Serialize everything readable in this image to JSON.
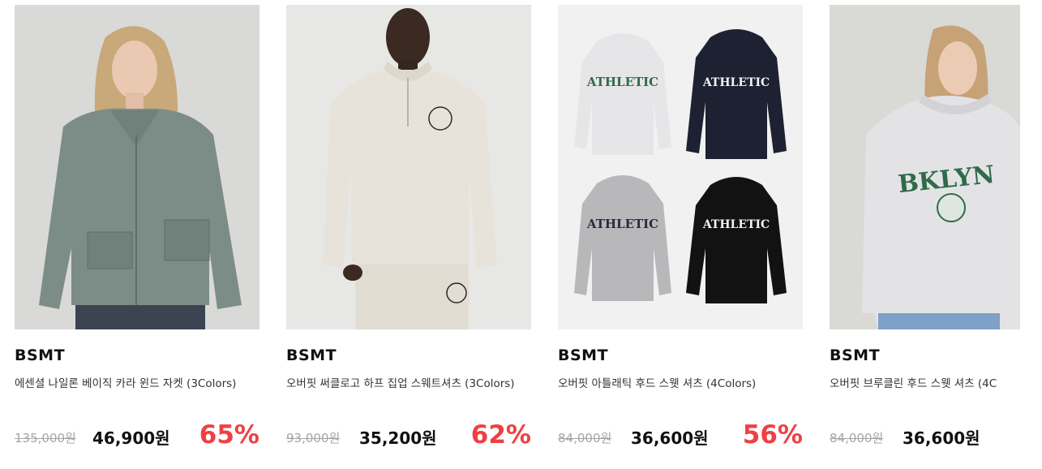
{
  "products": [
    {
      "brand": "BSMT",
      "name": "에센셜 나일론 베이직 카라 윈드 자켓 (3Colors)",
      "original_price": "135,000원",
      "sale_price": "46,900원",
      "discount": "65%"
    },
    {
      "brand": "BSMT",
      "name": "오버핏 써클로고 하프 집업 스웨트셔츠 (3Colors)",
      "original_price": "93,000원",
      "sale_price": "35,200원",
      "discount": "62%"
    },
    {
      "brand": "BSMT",
      "name": "오버핏 아틀래틱 후드 스웻 셔츠 (4Colors)",
      "original_price": "84,000원",
      "sale_price": "36,600원",
      "discount": "56%",
      "image_text": [
        "ATHLETIC",
        "ATHLETIC",
        "ATHLETIC",
        "ATHLETIC"
      ]
    },
    {
      "brand": "BSMT",
      "name": "오버핏 브루클린 후드 스웻 셔츠 (4C",
      "original_price": "84,000원",
      "sale_price": "36,600원",
      "image_text": "BKLYN"
    }
  ],
  "colors": {
    "discount": "#ef4043",
    "original_price": "#a5a5a5",
    "brand": "#111111"
  }
}
